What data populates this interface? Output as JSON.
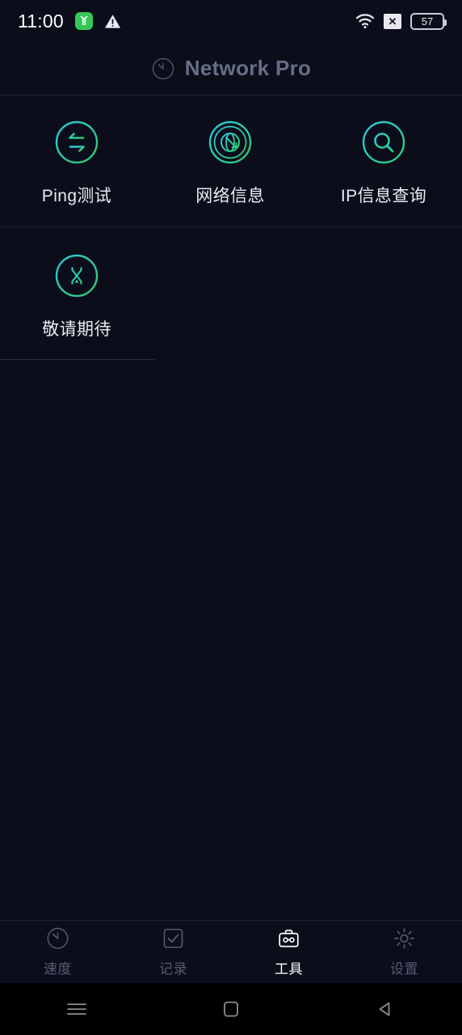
{
  "status_bar": {
    "time": "11:00",
    "left_icons": [
      "app-badge-green",
      "warning-triangle-icon"
    ],
    "wifi_icon": "wifi-icon",
    "signal_off_label": "✕",
    "battery_level": "57"
  },
  "header": {
    "title": "Network Pro",
    "logo_icon": "speedometer-icon"
  },
  "tools": {
    "rows": [
      [
        {
          "label": "Ping测试",
          "icon": "ping-exchange-icon"
        },
        {
          "label": "网络信息",
          "icon": "globe-network-icon"
        },
        {
          "label": "IP信息查询",
          "icon": "search-icon"
        }
      ],
      [
        {
          "label": "敬请期待",
          "icon": "hourglass-icon"
        }
      ]
    ]
  },
  "tabbar": {
    "items": [
      {
        "label": "速度",
        "icon": "speedometer-icon",
        "active": false
      },
      {
        "label": "记录",
        "icon": "checklist-icon",
        "active": false
      },
      {
        "label": "工具",
        "icon": "toolbox-icon",
        "active": true
      },
      {
        "label": "设置",
        "icon": "gear-icon",
        "active": false
      }
    ]
  },
  "android_nav": {
    "recents": "menu-icon",
    "home": "home-square-icon",
    "back": "back-triangle-icon"
  },
  "colors": {
    "background": "#0b0e1a",
    "accent_cyan": "#2ec7dd",
    "accent_green": "#2ecc71",
    "title_muted": "#666e86",
    "label": "#e9ebf2",
    "tab_inactive": "#535a73",
    "divider": "#1d2336"
  }
}
